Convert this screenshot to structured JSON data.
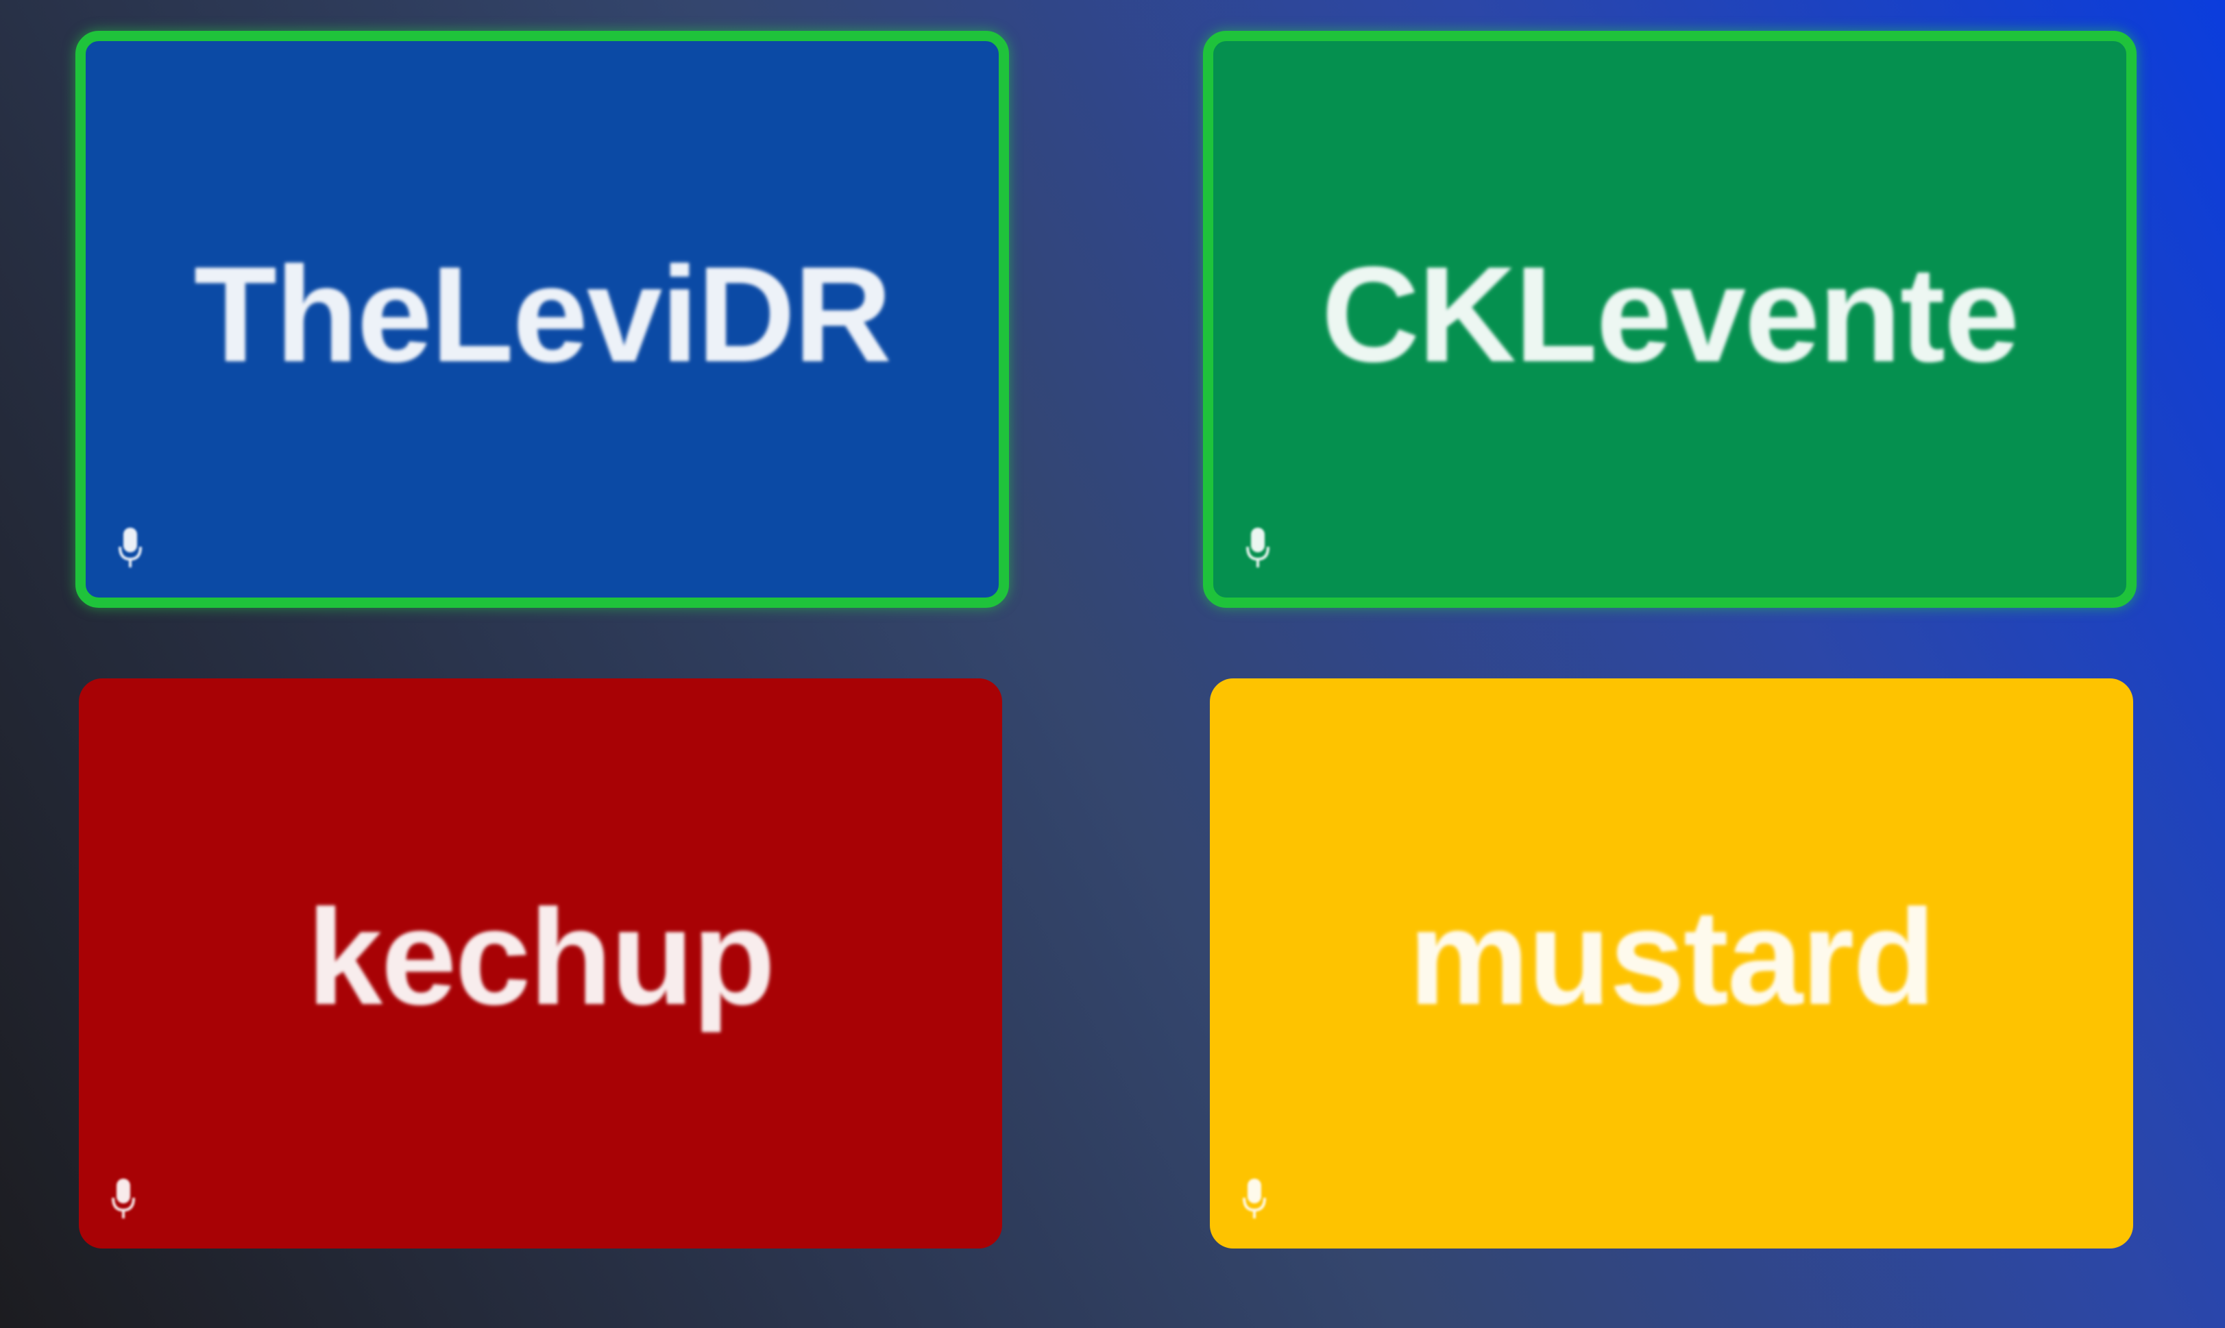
{
  "participants": [
    {
      "name": "TheLeviDR",
      "tile_color": "#0b4aa5",
      "speaking": true,
      "icon": "microphone-icon"
    },
    {
      "name": "CKLevente",
      "tile_color": "#05904f",
      "speaking": true,
      "icon": "microphone-icon"
    },
    {
      "name": "kechup",
      "tile_color": "#a80205",
      "speaking": false,
      "icon": "microphone-icon"
    },
    {
      "name": "mustard",
      "tile_color": "#fec300",
      "speaking": false,
      "icon": "microphone-icon"
    }
  ],
  "colors": {
    "speaking_border": "#1fc33b",
    "text": "#ffffff"
  }
}
